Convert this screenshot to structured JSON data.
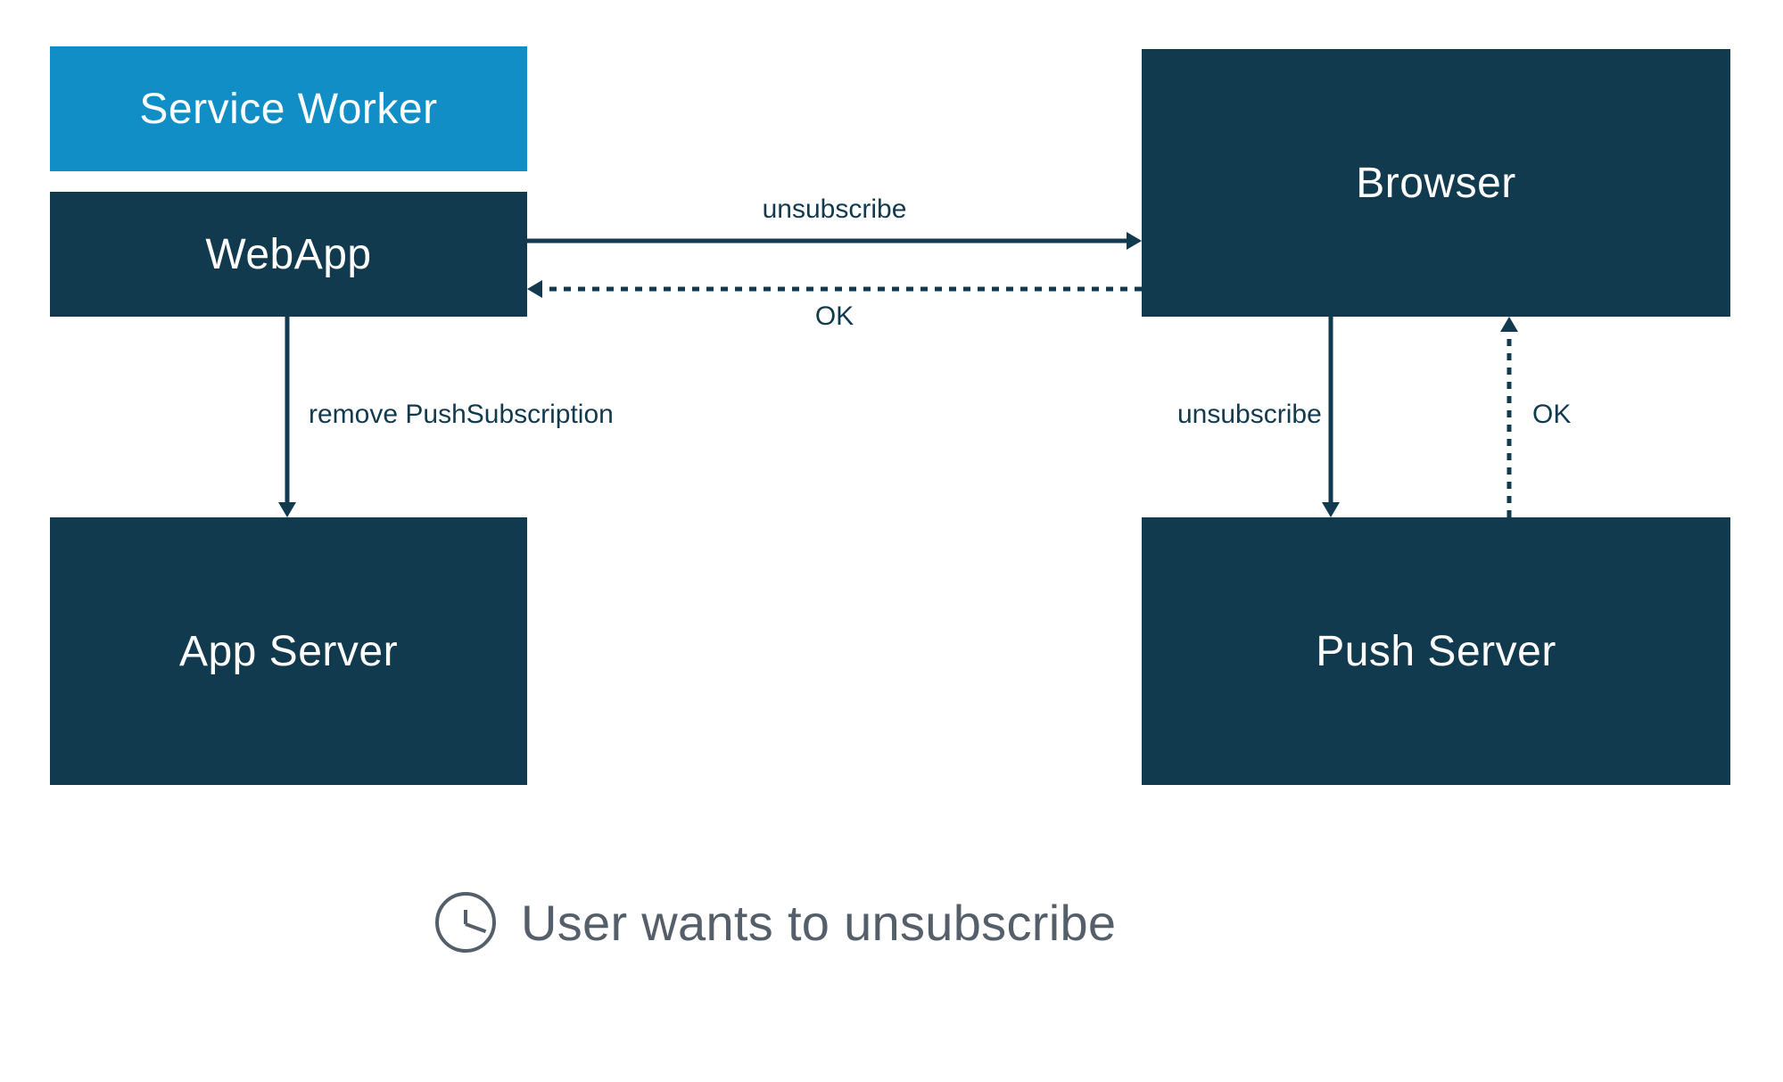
{
  "colors": {
    "dark": "#123a4f",
    "light": "#118ec6",
    "muted": "#555f69"
  },
  "nodes": {
    "serviceWorker": "Service Worker",
    "webApp": "WebApp",
    "browser": "Browser",
    "appServer": "App Server",
    "pushServer": "Push Server"
  },
  "edges": {
    "webapp_to_browser": "unsubscribe",
    "browser_to_webapp_ok": "OK",
    "webapp_to_appserver": "remove PushSubscription",
    "browser_to_pushserver": "unsubscribe",
    "pushserver_to_browser_ok": "OK"
  },
  "caption": "User wants to unsubscribe"
}
